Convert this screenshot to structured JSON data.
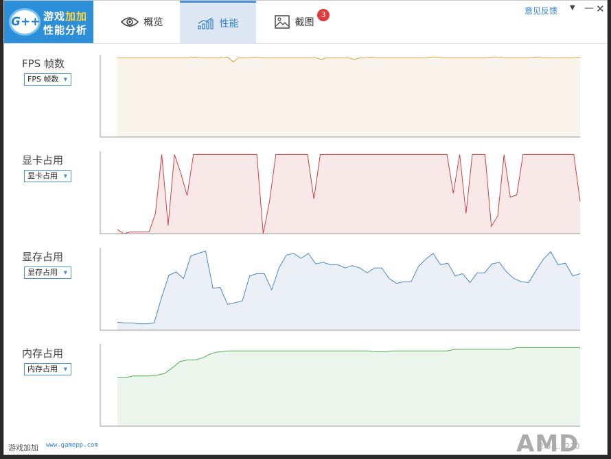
{
  "logo": {
    "badge": "G++",
    "line1_a": "游戏",
    "line1_b": "加加",
    "line2": "性能分析"
  },
  "tabs": [
    {
      "label": "概览",
      "icon": "eye-icon"
    },
    {
      "label": "性能",
      "icon": "trend-chart-icon"
    },
    {
      "label": "截图",
      "icon": "image-icon",
      "badge": "3"
    }
  ],
  "window_controls": {
    "feedback": "意见反馈",
    "menu": "▼",
    "minimize": "—",
    "close": "✕"
  },
  "footer": {
    "brand": "游戏加加",
    "url": "www.gamepp.com",
    "version": "2.8.1.1210",
    "vendor_logo": "AMD"
  },
  "charts": [
    {
      "title": "FPS 帧数",
      "dropdown": "FPS 帧数",
      "stroke": "#e0a040",
      "fill": "#f9f4ec",
      "ylim": [
        0,
        100
      ],
      "values": [
        98,
        98,
        98,
        98,
        98,
        98,
        98,
        98,
        98,
        98,
        98,
        98,
        98,
        98,
        99,
        98,
        98,
        98,
        98,
        98,
        99,
        93,
        98,
        98,
        98,
        99,
        98,
        98,
        98,
        98,
        98,
        98,
        98,
        98,
        98,
        98,
        98,
        96,
        98,
        98,
        98,
        98,
        98,
        96,
        98,
        98,
        99,
        98,
        98,
        98,
        98,
        98,
        98,
        98,
        98,
        98,
        98,
        99,
        99,
        98,
        98,
        98,
        98,
        98,
        98,
        98,
        98,
        98,
        99,
        99,
        98,
        98,
        98,
        98,
        98,
        98,
        99,
        98,
        98,
        98,
        98,
        98,
        98,
        98,
        99
      ]
    },
    {
      "title": "显卡占用",
      "dropdown": "显卡占用",
      "stroke": "#c9423e",
      "fill": "#f8e8e7",
      "ylim": [
        0,
        100
      ],
      "values": [
        5,
        0,
        2,
        2,
        2,
        2,
        25,
        98,
        10,
        98,
        75,
        47,
        98,
        98,
        98,
        98,
        98,
        98,
        98,
        98,
        98,
        98,
        98,
        0,
        40,
        98,
        98,
        98,
        98,
        98,
        98,
        43,
        98,
        98,
        98,
        98,
        98,
        98,
        98,
        98,
        98,
        98,
        98,
        98,
        98,
        98,
        98,
        98,
        98,
        98,
        98,
        98,
        98,
        50,
        98,
        25,
        98,
        98,
        98,
        9,
        22,
        98,
        45,
        48,
        98,
        98,
        98,
        98,
        98,
        98,
        98,
        98,
        98,
        40
      ]
    },
    {
      "title": "显存占用",
      "dropdown": "显存占用",
      "stroke": "#4a86c2",
      "fill": "#ebf0f7",
      "ylim": [
        0,
        100
      ],
      "values": [
        10,
        9,
        9,
        8,
        8,
        9,
        40,
        68,
        72,
        64,
        92,
        95,
        98,
        52,
        53,
        32,
        34,
        36,
        67,
        70,
        70,
        50,
        77,
        93,
        95,
        89,
        95,
        82,
        84,
        81,
        81,
        77,
        80,
        77,
        71,
        77,
        77,
        64,
        58,
        60,
        60,
        79,
        88,
        95,
        81,
        83,
        67,
        70,
        59,
        71,
        71,
        82,
        84,
        72,
        64,
        60,
        59,
        74,
        88,
        97,
        81,
        83,
        67,
        70
      ]
    },
    {
      "title": "内存占用",
      "dropdown": "内存占用",
      "stroke": "#4cae4c",
      "fill": "#ecf6ec",
      "ylim": [
        0,
        100
      ],
      "values": [
        60,
        60,
        62,
        62,
        62,
        63,
        65,
        72,
        80,
        82,
        82,
        85,
        90,
        92,
        93,
        93,
        93,
        93,
        93,
        93,
        93,
        93,
        93,
        93,
        93,
        93,
        93,
        93,
        93,
        93,
        93,
        93,
        93,
        92,
        92,
        93,
        93,
        93,
        93,
        93,
        93,
        93,
        93,
        95,
        95,
        95,
        95,
        95,
        95,
        95,
        95,
        97,
        97,
        97,
        97,
        97,
        97,
        97,
        97,
        97
      ]
    }
  ]
}
